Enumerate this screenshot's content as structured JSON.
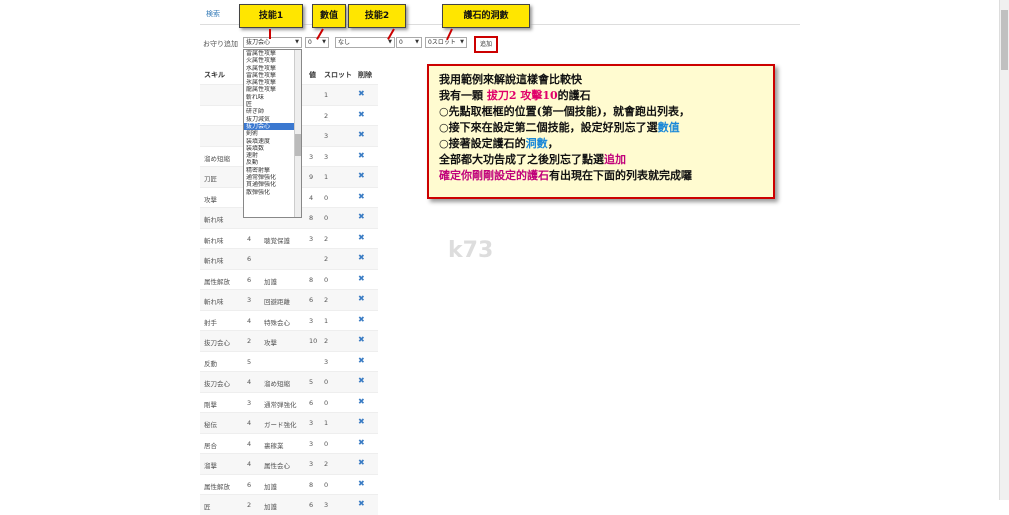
{
  "nav": {
    "tab_search": "検索"
  },
  "form": {
    "label": "お守り追加",
    "skill1_value": "抜刀会心",
    "value1": "0",
    "skill2_value": "なし",
    "value2": "0",
    "slot_value": "0スロット",
    "add_button": "追加"
  },
  "dropdown": {
    "items": [
      "雷属性攻撃",
      "火属性攻撃",
      "水属性攻撃",
      "雷属性攻撃",
      "氷属性攻撃",
      "龍属性攻撃",
      "斬れ味",
      "匠",
      "研ぎ師",
      "抜刀減気",
      "抜刀会心",
      "剣術",
      "装填速度",
      "装填数",
      "速射",
      "反動",
      "精密射撃",
      "通常弾強化",
      "貫通弾強化",
      "散弾強化"
    ],
    "selected_index": 10
  },
  "callouts": {
    "skill1": "技能1",
    "value": "數值",
    "skill2": "技能2",
    "slots": "護石的洞數"
  },
  "table": {
    "headers": [
      "スキル",
      "値",
      "スロット",
      "削除"
    ],
    "rows": [
      [
        "",
        "",
        "",
        "",
        "1"
      ],
      [
        "",
        "",
        "",
        "",
        "2"
      ],
      [
        "",
        "",
        "",
        "",
        "3"
      ],
      [
        "溜め短縮",
        "",
        "",
        "3",
        "3"
      ],
      [
        "刀匠",
        "",
        "",
        "9",
        "1"
      ],
      [
        "攻撃",
        "",
        "",
        "4",
        "0"
      ],
      [
        "斬れ味",
        "",
        "",
        "8",
        "0"
      ],
      [
        "斬れ味",
        "4",
        "聴覚保護",
        "3",
        "2"
      ],
      [
        "斬れ味",
        "6",
        "",
        "",
        "2"
      ],
      [
        "属性解放",
        "6",
        "加護",
        "8",
        "0"
      ],
      [
        "斬れ味",
        "3",
        "回避距離",
        "6",
        "2"
      ],
      [
        "射手",
        "4",
        "特殊会心",
        "3",
        "1"
      ],
      [
        "抜刀会心",
        "2",
        "攻撃",
        "10",
        "2"
      ],
      [
        "反動",
        "5",
        "",
        "",
        "3"
      ],
      [
        "抜刀会心",
        "4",
        "溜め短縮",
        "5",
        "0"
      ],
      [
        "剛撃",
        "3",
        "通常弾強化",
        "6",
        "0"
      ],
      [
        "秘伝",
        "4",
        "ガード強化",
        "3",
        "1"
      ],
      [
        "居合",
        "4",
        "裏稼業",
        "3",
        "0"
      ],
      [
        "溜撃",
        "4",
        "属性会心",
        "3",
        "2"
      ],
      [
        "属性解放",
        "6",
        "加護",
        "8",
        "0"
      ],
      [
        "匠",
        "2",
        "加護",
        "6",
        "3"
      ]
    ]
  },
  "info": {
    "line1": "我用範例來解說這樣會比較快",
    "line2_a": "我有一顆 ",
    "line2_b": "拔刀2 攻擊10",
    "line2_c": "的護石",
    "line3": "○先點取框框的位置(第一個技能)，就會跑出列表，",
    "line4_a": "○接下來在設定第二個技能，設定好別忘了選",
    "line4_b": "數值",
    "line5_a": "○接著設定護石的",
    "line5_b": "洞數",
    "line5_c": "，",
    "line6_a": "全部都大功告成了之後別忘了點選",
    "line6_b": "追加",
    "line7_a": "確定你剛剛設定的護石",
    "line7_b": "有出現在下面的列表就完成囉"
  },
  "watermark": "k73",
  "colors": {
    "accent_red": "#cc0000",
    "callout_yellow": "#ffe600",
    "link_blue": "#337ab7"
  }
}
